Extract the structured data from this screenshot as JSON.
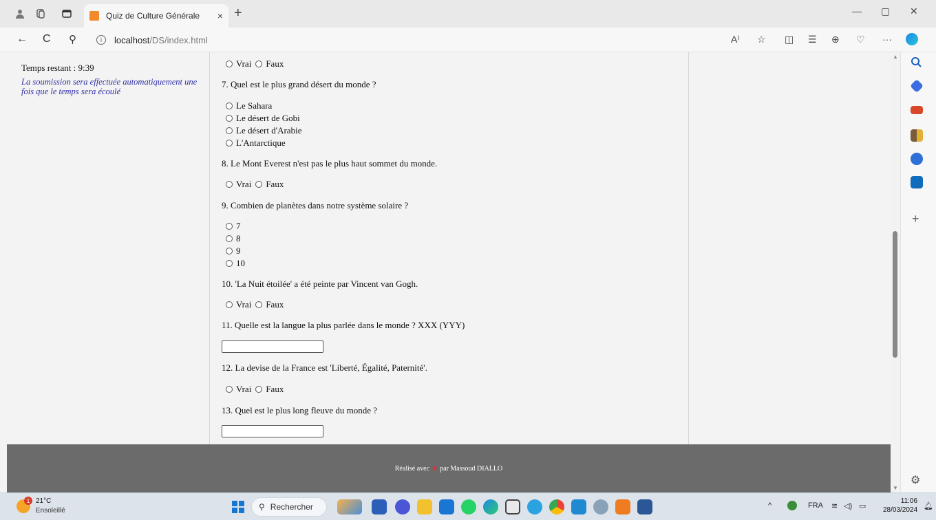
{
  "browser": {
    "tab_title": "Quiz de Culture Générale",
    "tab_close": "×",
    "new_tab": "+",
    "url_host": "localhost",
    "url_path": "/DS/index.html",
    "minimize": "—",
    "maximize": "▢",
    "close": "✕",
    "back": "←",
    "reload": "C",
    "search": "⚲",
    "tools": [
      "A⁾",
      "☆",
      "◫",
      "☰",
      "⊕",
      "♡",
      "···"
    ]
  },
  "sidebar": {
    "timer_text": "Temps restant : 9:39",
    "note": "La soumission sera effectuée automatiquement une fois que le temps sera écoulé"
  },
  "quiz": {
    "q6_options": [
      "Vrai",
      "Faux"
    ],
    "q7": {
      "text": "7. Quel est le plus grand désert du monde ?",
      "options": [
        "Le Sahara",
        "Le désert de Gobi",
        "Le désert d'Arabie",
        "L'Antarctique"
      ]
    },
    "q8": {
      "text": "8. Le Mont Everest n'est pas le plus haut sommet du monde.",
      "options": [
        "Vrai",
        "Faux"
      ]
    },
    "q9": {
      "text": "9. Combien de planètes dans notre système solaire ?",
      "options": [
        "7",
        "8",
        "9",
        "10"
      ]
    },
    "q10": {
      "text": "10. 'La Nuit étoilée' a été peinte par Vincent van Gogh.",
      "options": [
        "Vrai",
        "Faux"
      ]
    },
    "q11": {
      "text": "11. Quelle est la langue la plus parlée dans le monde ? XXX (YYY)",
      "value": ""
    },
    "q12": {
      "text": "12. La devise de la France est 'Liberté, Égalité, Paternité'.",
      "options": [
        "Vrai",
        "Faux"
      ]
    },
    "q13": {
      "text": "13. Quel est le plus long fleuve du monde ?",
      "value": ""
    }
  },
  "footer": {
    "before": "Réalisé avec",
    "heart": "♥",
    "after": "par Massoud DIALLO"
  },
  "taskbar": {
    "weather_badge": "1",
    "temperature": "21°C",
    "weather_desc": "Ensoleillé",
    "search_placeholder": "Rechercher",
    "language": "FRA",
    "time": "11:06",
    "date": "28/03/2024"
  },
  "colors": {
    "note": "#3030a8",
    "footer_bg": "#6b6b6b",
    "heart": "#e03030"
  }
}
